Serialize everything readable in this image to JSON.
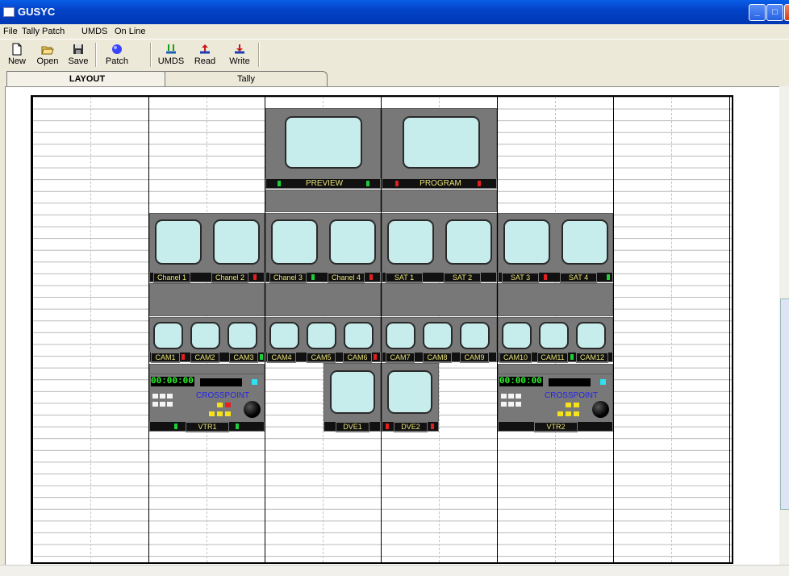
{
  "window": {
    "title": "GUSYC",
    "minimize": "_",
    "maximize": "□",
    "close": "X"
  },
  "menu": [
    "File",
    "Tally Patch",
    "UMDS",
    "On Line"
  ],
  "toolbar": {
    "new": "New",
    "open": "Open",
    "save": "Save",
    "patch": "Patch",
    "umds": "UMDS",
    "read": "Read",
    "write": "Write"
  },
  "tabs": {
    "layout": "LAYOUT",
    "tally": "Tally"
  },
  "monitors": {
    "preview": "PREVIEW",
    "program": "PROGRAM",
    "row2": [
      "Chanel 1",
      "Chanel 2",
      "Chanel 3",
      "Chanel 4",
      "SAT 1",
      "SAT 2",
      "SAT 3",
      "SAT 4"
    ],
    "cams": [
      "CAM1",
      "CAM2",
      "CAM3",
      "CAM4",
      "CAM5",
      "CAM6",
      "CAM7",
      "CAM8",
      "CAM9",
      "CAM10",
      "CAM11",
      "CAM12"
    ],
    "dve1": "DVE1",
    "dve2": "DVE2"
  },
  "vtr1": {
    "time": "00:00:00",
    "label": "CROSSPOINT",
    "name": "VTR1"
  },
  "vtr2": {
    "time": "00:00:00",
    "label": "CROSSPOINT",
    "name": "VTR2"
  },
  "colors": {
    "tally_red": "#e02020",
    "tally_green": "#1fcc3a",
    "screen": "#c6ecec",
    "panel": "#787878"
  }
}
